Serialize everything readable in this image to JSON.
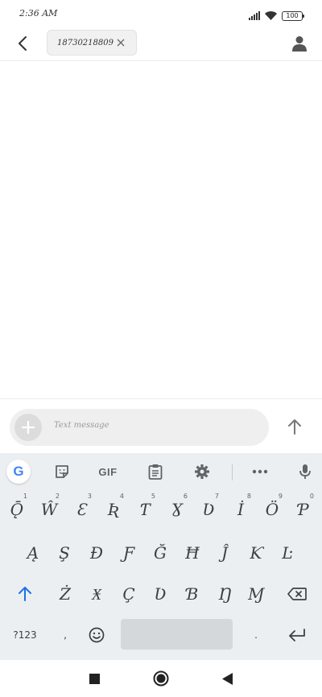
{
  "status_bar": {
    "time": "2:36 AM",
    "battery": "100",
    "icons": [
      "signal-icon",
      "wifi-icon",
      "battery-icon"
    ]
  },
  "header": {
    "back_icon": "back-arrow-icon",
    "recipient": "18730218809",
    "remove_icon": "close-icon",
    "contact_icon": "person-icon"
  },
  "compose": {
    "placeholder": "Text message",
    "add_icon": "plus-icon",
    "send_icon": "send-arrow-icon"
  },
  "keyboard": {
    "toolbar": {
      "google": "G",
      "gif": "GIF",
      "icons": [
        "google-icon",
        "sticker-icon",
        "gif-icon",
        "clipboard-icon",
        "settings-icon",
        "more-icon",
        "microphone-icon"
      ]
    },
    "row1": [
      {
        "label": "Ǭ",
        "hint": "1"
      },
      {
        "label": "Ŵ",
        "hint": "2"
      },
      {
        "label": "Ɛ",
        "hint": "3"
      },
      {
        "label": "Ʀ",
        "hint": "4"
      },
      {
        "label": "Ƭ",
        "hint": "5"
      },
      {
        "label": "Ɣ",
        "hint": "6"
      },
      {
        "label": "Ʋ",
        "hint": "7"
      },
      {
        "label": "İ",
        "hint": "8"
      },
      {
        "label": "Ö",
        "hint": "9"
      },
      {
        "label": "Ƥ",
        "hint": "0"
      }
    ],
    "row2": [
      "Ą",
      "Ş",
      "Ɖ",
      "Ƒ",
      "Ğ",
      "Ħ",
      "Ĵ",
      "Ƙ",
      "Ŀ"
    ],
    "row3": [
      "Ż",
      "Ӿ",
      "Ç",
      "Ʋ",
      "Ɓ",
      "Ŋ",
      "Ɱ"
    ],
    "row4": {
      "symbols": "?123",
      "comma": ",",
      "emoji_icon": "emoji-icon",
      "period": ".",
      "enter_icon": "enter-icon"
    },
    "shift_icon": "shift-arrow-icon",
    "backspace_icon": "backspace-icon"
  },
  "nav_bar": {
    "icons": [
      "recents-square-icon",
      "home-circle-icon",
      "back-triangle-icon"
    ]
  },
  "colors": {
    "accent_blue": "#1a73e8",
    "keyboard_bg": "#eceff1",
    "compose_bg": "#efefef"
  }
}
